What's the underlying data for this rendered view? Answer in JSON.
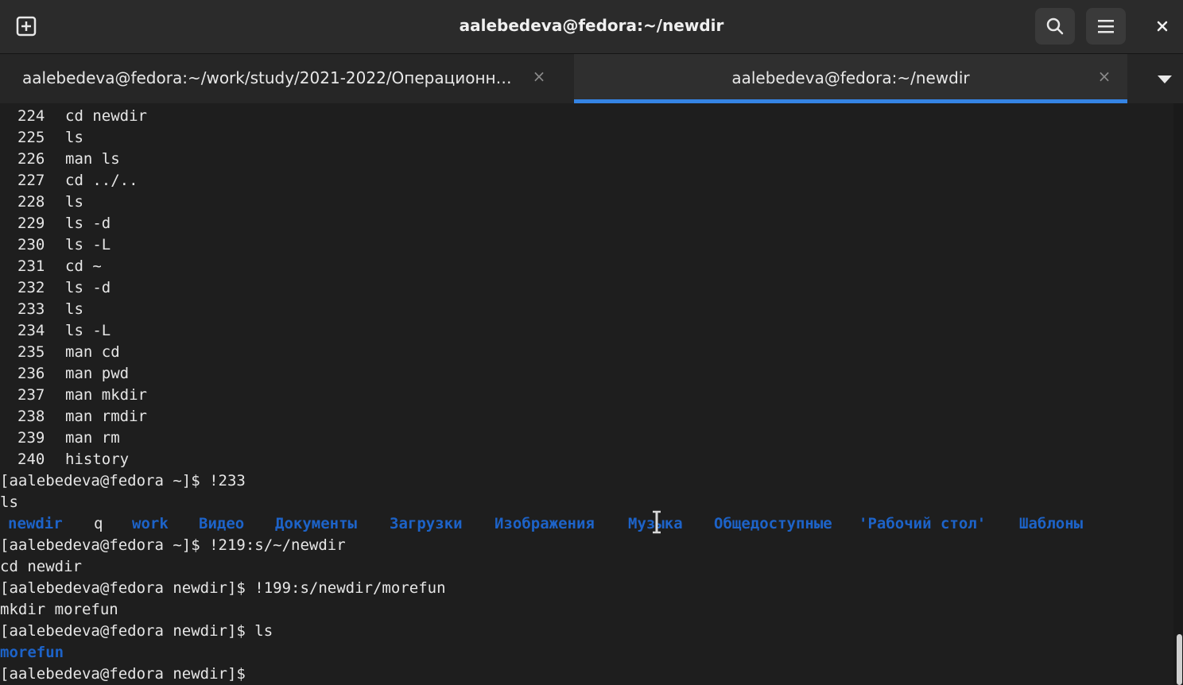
{
  "window": {
    "title": "aalebedeva@fedora:~/newdir",
    "close_glyph": "×"
  },
  "icons": {
    "new_tab": "new-tab-icon",
    "search": "search-icon",
    "menu": "hamburger-menu-icon",
    "close": "close-icon",
    "tab_dropdown": "chevron-down-icon"
  },
  "tabs": [
    {
      "label": "aalebedeva@fedora:~/work/study/2021-2022/Операционны...",
      "close": "×",
      "active": false
    },
    {
      "label": "aalebedeva@fedora:~/newdir",
      "close": "×",
      "active": true
    }
  ],
  "colors": {
    "accent": "#3584e4",
    "directory": "#1d63c8",
    "terminal_bg": "#1e1e1e",
    "text": "#e6e6e6"
  },
  "history": [
    {
      "num": "224",
      "cmd": "cd newdir"
    },
    {
      "num": "225",
      "cmd": "ls"
    },
    {
      "num": "226",
      "cmd": "man ls"
    },
    {
      "num": "227",
      "cmd": "cd ../.."
    },
    {
      "num": "228",
      "cmd": "ls"
    },
    {
      "num": "229",
      "cmd": "ls -d"
    },
    {
      "num": "230",
      "cmd": "ls -L"
    },
    {
      "num": "231",
      "cmd": "cd ~"
    },
    {
      "num": "232",
      "cmd": "ls -d"
    },
    {
      "num": "233",
      "cmd": "ls"
    },
    {
      "num": "234",
      "cmd": "ls -L"
    },
    {
      "num": "235",
      "cmd": "man cd"
    },
    {
      "num": "236",
      "cmd": "man pwd"
    },
    {
      "num": "237",
      "cmd": "man mkdir"
    },
    {
      "num": "238",
      "cmd": "man rmdir"
    },
    {
      "num": "239",
      "cmd": "man rm"
    },
    {
      "num": "240",
      "cmd": "history"
    }
  ],
  "session": {
    "line1": "[aalebedeva@fedora ~]$ !233",
    "line2": "ls",
    "ls_output": [
      {
        "name": "newdir",
        "type": "dir"
      },
      {
        "name": "q",
        "type": "file"
      },
      {
        "name": "work",
        "type": "dir"
      },
      {
        "name": "Видео",
        "type": "dir"
      },
      {
        "name": "Документы",
        "type": "dir"
      },
      {
        "name": "Загрузки",
        "type": "dir"
      },
      {
        "name": "Изображения",
        "type": "dir"
      },
      {
        "name": "Музыка",
        "type": "dir"
      },
      {
        "name": "Общедоступные",
        "type": "dir"
      },
      {
        "name": "'Рабочий стол'",
        "type": "dir"
      },
      {
        "name": "Шаблоны",
        "type": "dir"
      }
    ],
    "line4": "[aalebedeva@fedora ~]$ !219:s/~/newdir",
    "line5": "cd newdir",
    "line6": "[aalebedeva@fedora newdir]$ !199:s/newdir/morefun",
    "line7": "mkdir morefun",
    "line8": "[aalebedeva@fedora newdir]$ ls",
    "line9_dir": "morefun",
    "line10": "[aalebedeva@fedora newdir]$"
  }
}
